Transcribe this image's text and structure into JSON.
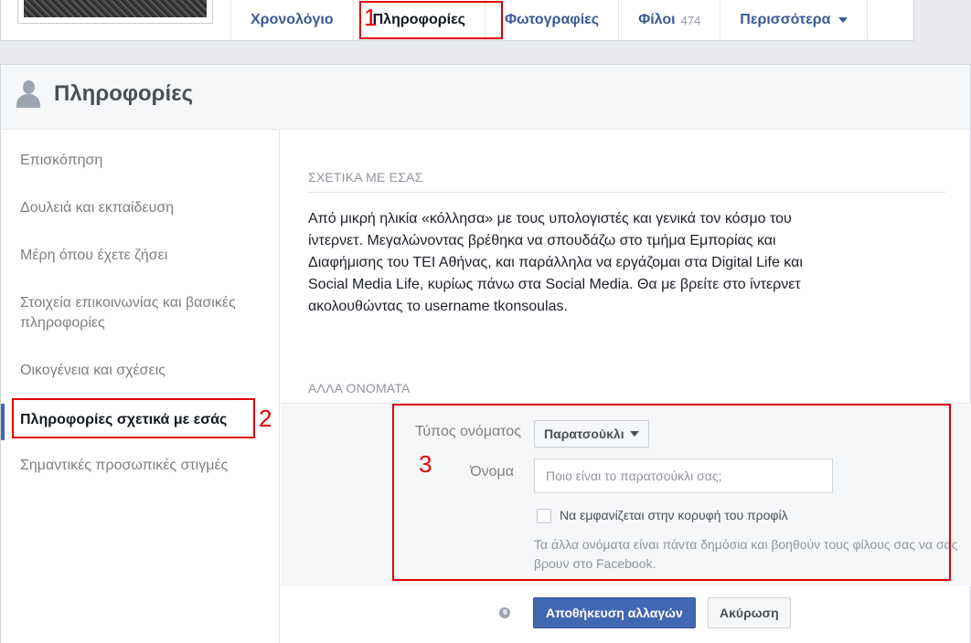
{
  "tabs": [
    {
      "label": "Χρονολόγιο"
    },
    {
      "label": "Πληροφορίες"
    },
    {
      "label": "Φωτογραφίες"
    },
    {
      "label": "Φίλοι",
      "count": "474"
    },
    {
      "label": "Περισσότερα"
    }
  ],
  "panel": {
    "title": "Πληροφορίες"
  },
  "sidebar": {
    "items": [
      {
        "label": "Επισκόπηση"
      },
      {
        "label": "Δουλειά και εκπαίδευση"
      },
      {
        "label": "Μέρη όπου έχετε ζήσει"
      },
      {
        "label": "Στοιχεία επικοινωνίας και βασικές πληροφορίες"
      },
      {
        "label": "Οικογένεια και σχέσεις"
      },
      {
        "label": "Πληροφορίες σχετικά με εσάς"
      },
      {
        "label": "Σημαντικές προσωπικές στιγμές"
      }
    ]
  },
  "about": {
    "heading": "ΣΧΕΤΙΚΑ ΜΕ ΕΣΑΣ",
    "text": "Από μικρή ηλικία «κόλλησα» με τους υπολογιστές και γενικά τον κόσμο του ίντερνετ. Μεγαλώνοντας βρέθηκα να σπουδάζω στο τμήμα Εμπορίας και Διαφήμισης του ΤΕΙ Αθήνας, και παράλληλα να εργάζομαι στα Digital Life και Social Media Life, κυρίως πάνω στα Social Media. Θα με βρείτε στο ίντερνετ ακολουθώντας το username tkonsoulas."
  },
  "other_names": {
    "heading": "ΑΛΛΑ ΟΝΟΜΑΤΑ",
    "type_label": "Τύπος ονόματος",
    "type_value": "Παρατσούκλι",
    "name_label": "Όνομα",
    "name_value": "",
    "name_placeholder": "Ποιο είναι το παρατσούκλι σας;",
    "checkbox_label": "Να εμφανίζεται στην κορυφή του προφίλ",
    "help_text": "Τα άλλα ονόματα είναι πάντα δημόσια και βοηθούν τους φίλους σας να σας βρουν στο Facebook."
  },
  "buttons": {
    "save": "Αποθήκευση αλλαγών",
    "cancel": "Ακύρωση"
  },
  "annotations": [
    "1",
    "2",
    "3"
  ],
  "colors": {
    "accent": "#3b5998",
    "button": "#4267b2",
    "annotation": "#e00000"
  }
}
